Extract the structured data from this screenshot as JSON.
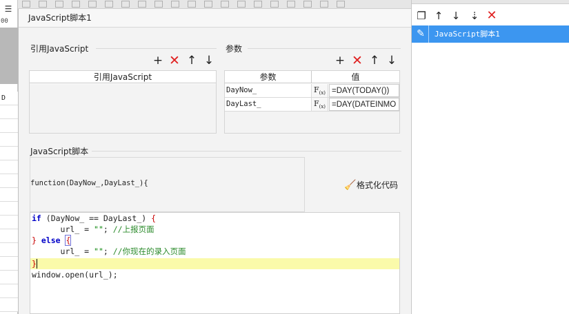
{
  "background": {
    "left_header": "00",
    "left_cell": "D"
  },
  "dialog": {
    "title": "JavaScript脚本1",
    "references": {
      "section_title": "引用JavaScript",
      "column_header": "引用JavaScript"
    },
    "params": {
      "section_title": "参数",
      "columns": [
        "参数",
        "值"
      ],
      "rows": [
        {
          "name": "DayNow_",
          "fx": "F(x)",
          "value": "=DAY(TODAY())"
        },
        {
          "name": "DayLast_",
          "fx": "F(x)",
          "value": "=DAY(DATEINMO"
        }
      ]
    },
    "script": {
      "section_title": "JavaScript脚本",
      "signature": "function(DayNow_,DayLast_){",
      "format_button": "格式化代码",
      "code_lines": {
        "l1_if": "if",
        "l1_rest": " (DayNow_ == DayLast_) ",
        "l1_brace": "{",
        "l2_code": "      url_ = ",
        "l2_str": "\"\"",
        "l2_semi": "; ",
        "l2_comment": "//上报页面",
        "l3_brace": "}",
        "l3_else": " else ",
        "l3_brace2": "{",
        "l4_code": "      url_ = ",
        "l4_str": "\"\"",
        "l4_semi": "; ",
        "l4_comment": "//你现在的录入页面",
        "l5_brace": "}",
        "l6_code": "window.open(url_);"
      }
    }
  },
  "right_panel": {
    "selected_item": "JavaScript脚本1"
  },
  "icons": {
    "add": "+",
    "delete": "✕",
    "up": "↑",
    "down": "↓",
    "copy": "❐",
    "sort_down": "⇣",
    "edit": "✎",
    "broom": "🧹"
  },
  "colors": {
    "accent": "#3c96f0",
    "delete_red": "#e02020",
    "keyword": "#0000c8",
    "brace": "#c80000",
    "comment": "#2a8a2a",
    "line_highlight": "#fafaaa"
  }
}
